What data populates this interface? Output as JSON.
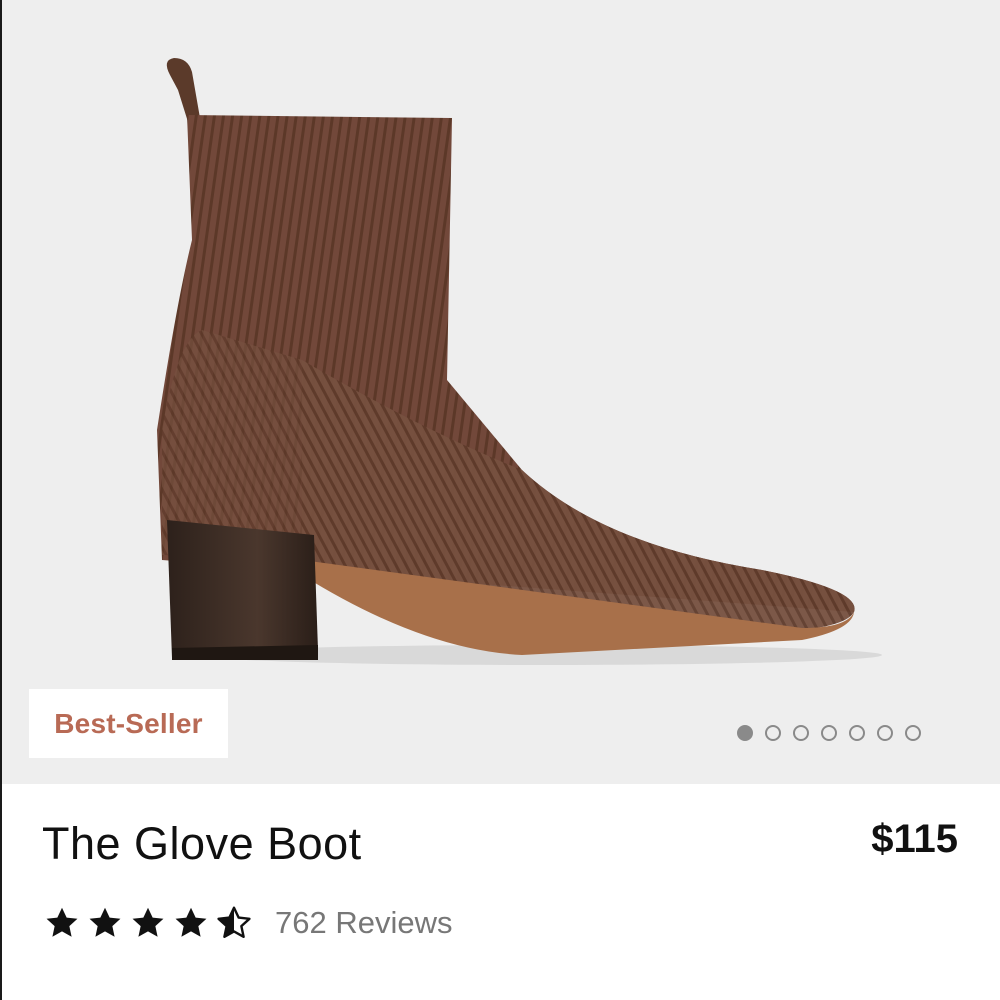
{
  "product": {
    "image_alt": "Brown ribbed knit ankle boot with block heel",
    "badge": "Best-Seller",
    "title": "The Glove Boot",
    "price": "$115",
    "rating": 4.5,
    "reviews_label": "762 Reviews",
    "carousel": {
      "total": 7,
      "active_index": 0
    }
  },
  "icons": {
    "star": "star-icon",
    "half_star": "star-half-icon"
  },
  "colors": {
    "badge_text": "#b86a55",
    "image_bg": "#eeeeee",
    "boot_knit": "#6e4533",
    "heel": "#3a2a22",
    "sole": "#b07a52"
  }
}
